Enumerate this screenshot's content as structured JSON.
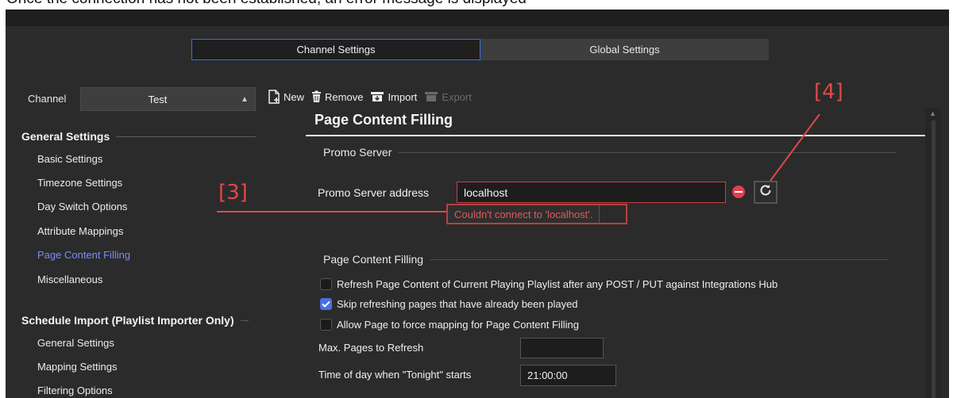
{
  "caption": "Once the connection has not been established, an error message is displayed",
  "tabs": {
    "channel": "Channel Settings",
    "global": "Global Settings"
  },
  "channel": {
    "label": "Channel",
    "value": "Test"
  },
  "toolbar": {
    "new_label": "New",
    "remove_label": "Remove",
    "import_label": "Import",
    "export_label": "Export"
  },
  "nav": {
    "general_title": "General Settings",
    "general_items": [
      "Basic Settings",
      "Timezone Settings",
      "Day Switch Options",
      "Attribute Mappings",
      "Page Content Filling",
      "Miscellaneous"
    ],
    "schedule_title": "Schedule Import (Playlist Importer Only)",
    "schedule_items": [
      "General Settings",
      "Mapping Settings",
      "Filtering Options"
    ]
  },
  "page": {
    "title": "Page Content Filling",
    "promo_section": "Promo Server",
    "promo_label": "Promo Server address",
    "promo_value": "localhost",
    "promo_error": "Couldn't connect to 'localhost'.",
    "filling_section": "Page Content Filling",
    "check1": "Refresh Page Content of Current Playing Playlist after any POST / PUT against Integrations Hub",
    "check2": "Skip refreshing pages that have already been played",
    "check3": "Allow Page to force mapping for Page Content Filling",
    "max_pages_label": "Max. Pages to Refresh",
    "max_pages_value": "",
    "tonight_label": "Time of day when \"Tonight\" starts",
    "tonight_value": "21:00:00"
  },
  "checks": {
    "check1": false,
    "check2": true,
    "check3": false
  },
  "annotations": {
    "a3": "[3]",
    "a4": "[4]"
  },
  "colors": {
    "accent": "#4a6fe2",
    "error": "#e05a5a",
    "annotation": "#e04848",
    "active_nav": "#7d8cf5"
  }
}
